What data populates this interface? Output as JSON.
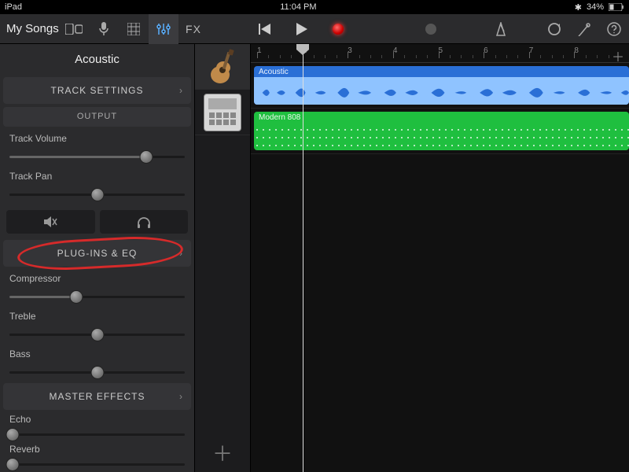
{
  "status": {
    "device": "iPad",
    "time": "11:04 PM",
    "battery": "34%"
  },
  "toolbar": {
    "my_songs": "My Songs",
    "fx": "FX"
  },
  "inspector": {
    "track_name": "Acoustic",
    "sections": {
      "track_settings": "TRACK SETTINGS",
      "output": "OUTPUT",
      "plugins": "PLUG-INS & EQ",
      "master_effects": "MASTER EFFECTS"
    },
    "sliders": {
      "volume": {
        "label": "Track Volume",
        "value": 78
      },
      "pan": {
        "label": "Track Pan",
        "value": 50
      },
      "compressor": {
        "label": "Compressor",
        "value": 38
      },
      "treble": {
        "label": "Treble",
        "value": 50
      },
      "bass": {
        "label": "Bass",
        "value": 50
      },
      "echo": {
        "label": "Echo",
        "value": 0
      },
      "reverb": {
        "label": "Reverb",
        "value": 0
      }
    }
  },
  "tracks": [
    {
      "name": "Acoustic",
      "color": "#2a6fd6",
      "kind": "audio"
    },
    {
      "name": "Modern 808",
      "color": "#1fbf3f",
      "kind": "midi"
    }
  ],
  "timeline": {
    "bars": [
      1,
      2,
      3,
      4,
      5,
      6,
      7,
      8
    ],
    "playhead_bar": 2
  }
}
